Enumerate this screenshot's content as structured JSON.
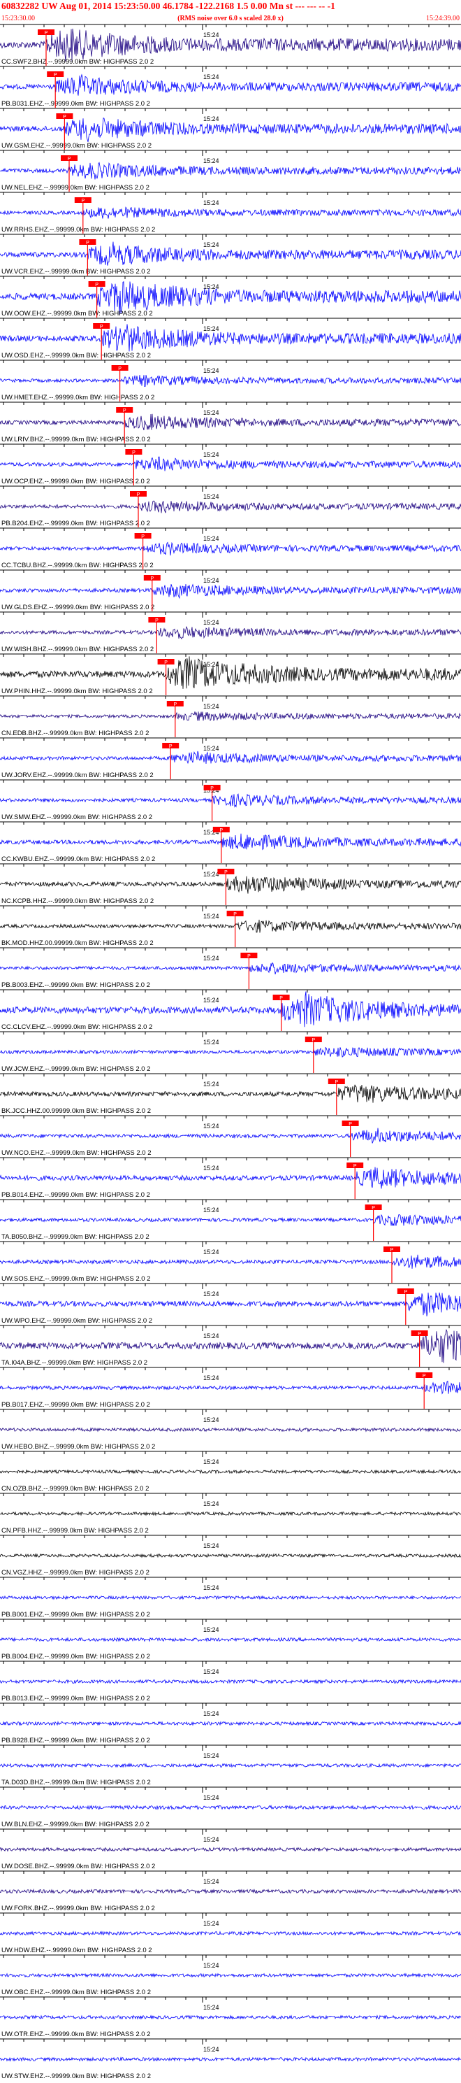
{
  "header": {
    "title": "60832282 UW Aug 01, 2014 15:23:50.00   46.1784 -122.2168  1.5 0.00 Mn st --- --- --  -1",
    "subtitle": "(RMS noise over 6.0 s scaled 28.0 x)",
    "time_start": "15:23:30.00",
    "time_end": "15:24:39.00"
  },
  "chart_data": {
    "type": "seismogram",
    "x_start": "15:23:30.00",
    "x_end": "15:24:39.00",
    "tick_label": "15:24",
    "pick_label": "P",
    "colors": {
      "blue": "#0000ff",
      "black": "#000000",
      "navy": "#1a0080",
      "pick": "#ff0000"
    },
    "traces": [
      {
        "label": "CC.SWF2.BHZ.--.99999.0km BW: HIGHPASS  2.0  2",
        "color": "navy",
        "amplitude": 1.0,
        "pick": 0.1
      },
      {
        "label": "PB.B031.EHZ.--.99999.0km BW: HIGHPASS  2.0  2",
        "color": "blue",
        "amplitude": 0.6,
        "pick": 0.12
      },
      {
        "label": "UW.GSM.EHZ.--.99999.0km BW: HIGHPASS  2.0  2",
        "color": "blue",
        "amplitude": 0.7,
        "pick": 0.14
      },
      {
        "label": "UW.NEL.EHZ.--.99999.0km BW: HIGHPASS  2.0  2",
        "color": "blue",
        "amplitude": 0.45,
        "pick": 0.15
      },
      {
        "label": "UW.RRHS.EHZ.--.99999.0km BW: HIGHPASS  2.0  2",
        "color": "blue",
        "amplitude": 0.3,
        "pick": 0.18
      },
      {
        "label": "UW.VCR.EHZ.--.99999.0km BW: HIGHPASS  2.0  2",
        "color": "blue",
        "amplitude": 0.65,
        "pick": 0.19
      },
      {
        "label": "UW.OOW.EHZ.--.99999.0km BW: HIGHPASS  2.0  2",
        "color": "blue",
        "amplitude": 1.0,
        "pick": 0.21
      },
      {
        "label": "UW.OSD.EHZ.--.99999.0km BW: HIGHPASS  2.0  2",
        "color": "blue",
        "amplitude": 0.8,
        "pick": 0.22
      },
      {
        "label": "UW.HMET.EHZ.--.99999.0km BW: HIGHPASS  2.0  2",
        "color": "blue",
        "amplitude": 0.25,
        "pick": 0.26
      },
      {
        "label": "UW.LRIV.BHZ.--.99999.0km BW: HIGHPASS  2.0  2",
        "color": "navy",
        "amplitude": 0.4,
        "pick": 0.27
      },
      {
        "label": "UW.OCP.EHZ.--.99999.0km BW: HIGHPASS  2.0  2",
        "color": "blue",
        "amplitude": 0.35,
        "pick": 0.29
      },
      {
        "label": "PB.B204.EHZ.--.99999.0km BW: HIGHPASS  2.0  2",
        "color": "navy",
        "amplitude": 0.3,
        "pick": 0.3
      },
      {
        "label": "CC.TCBU.BHZ.--.99999.0km BW: HIGHPASS  2.0  2",
        "color": "blue",
        "amplitude": 0.3,
        "pick": 0.31
      },
      {
        "label": "UW.GLDS.EHZ.--.99999.0km BW: HIGHPASS  2.0  2",
        "color": "blue",
        "amplitude": 0.35,
        "pick": 0.33
      },
      {
        "label": "UW.WISH.BHZ.--.99999.0km BW: HIGHPASS  2.0  2",
        "color": "navy",
        "amplitude": 0.3,
        "pick": 0.34
      },
      {
        "label": "UW.PHIN.HHZ.--.99999.0km BW: HIGHPASS  2.0  2",
        "color": "black",
        "amplitude": 1.0,
        "pick": 0.36
      },
      {
        "label": "CN.EDB.BHZ.--.99999.0km BW: HIGHPASS  2.0  2",
        "color": "navy",
        "amplitude": 0.2,
        "pick": 0.38
      },
      {
        "label": "UW.JORV.EHZ.--.99999.0km BW: HIGHPASS  2.0  2",
        "color": "blue",
        "amplitude": 0.3,
        "pick": 0.37
      },
      {
        "label": "UW.SMW.EHZ.--.99999.0km BW: HIGHPASS  2.0  2",
        "color": "blue",
        "amplitude": 0.3,
        "pick": 0.46
      },
      {
        "label": "CC.KWBU.EHZ.--.99999.0km BW: HIGHPASS  2.0  2",
        "color": "blue",
        "amplitude": 0.45,
        "pick": 0.48
      },
      {
        "label": "NC.KCPB.HHZ.--.99999.0km BW: HIGHPASS  2.0  2",
        "color": "black",
        "amplitude": 0.5,
        "pick": 0.49
      },
      {
        "label": "BK.MOD.HHZ.00.99999.0km BW: HIGHPASS  2.0  2",
        "color": "black",
        "amplitude": 0.3,
        "pick": 0.51
      },
      {
        "label": "PB.B003.EHZ.--.99999.0km BW: HIGHPASS  2.0  2",
        "color": "blue",
        "amplitude": 0.25,
        "pick": 0.54
      },
      {
        "label": "CC.CLCV.EHZ.--.99999.0km BW: HIGHPASS  2.0  2",
        "color": "blue",
        "amplitude": 1.0,
        "pick": 0.61
      },
      {
        "label": "UW.JCW.EHZ.--.99999.0km BW: HIGHPASS  2.0  2",
        "color": "blue",
        "amplitude": 0.25,
        "pick": 0.68
      },
      {
        "label": "BK.JCC.HHZ.00.99999.0km BW: HIGHPASS  2.0  2",
        "color": "black",
        "amplitude": 0.55,
        "pick": 0.73
      },
      {
        "label": "UW.NCO.EHZ.--.99999.0km BW: HIGHPASS  2.0  2",
        "color": "blue",
        "amplitude": 0.35,
        "pick": 0.76
      },
      {
        "label": "PB.B014.EHZ.--.99999.0km BW: HIGHPASS  2.0  2",
        "color": "blue",
        "amplitude": 0.6,
        "pick": 0.77
      },
      {
        "label": "TA.B050.BHZ.--.99999.0km BW: HIGHPASS  2.0  2",
        "color": "blue",
        "amplitude": 0.3,
        "pick": 0.81
      },
      {
        "label": "UW.SOS.EHZ.--.99999.0km BW: HIGHPASS  2.0  2",
        "color": "blue",
        "amplitude": 0.35,
        "pick": 0.85
      },
      {
        "label": "UW.WPO.EHZ.--.99999.0km BW: HIGHPASS  2.0  2",
        "color": "blue",
        "amplitude": 0.7,
        "pick": 0.88
      },
      {
        "label": "TA.I04A.BHZ.--.99999.0km BW: HIGHPASS  2.0  2",
        "color": "navy",
        "amplitude": 1.0,
        "pick": 0.91
      },
      {
        "label": "PB.B017.EHZ.--.99999.0km BW: HIGHPASS  2.0  2",
        "color": "blue",
        "amplitude": 0.3,
        "pick": 0.92
      },
      {
        "label": "UW.HEBO.BHZ.--.99999.0km BW: HIGHPASS  2.0  2",
        "color": "navy",
        "amplitude": 0.25,
        "pick": null
      },
      {
        "label": "CN.OZB.BHZ.--.99999.0km BW: HIGHPASS  2.0  2",
        "color": "black",
        "amplitude": 0.2,
        "pick": null
      },
      {
        "label": "CN.PFB.HHZ.--.99999.0km BW: HIGHPASS  2.0  2",
        "color": "black",
        "amplitude": 0.2,
        "pick": null
      },
      {
        "label": "CN.VGZ.HHZ.--.99999.0km BW: HIGHPASS  2.0  2",
        "color": "black",
        "amplitude": 0.2,
        "pick": null
      },
      {
        "label": "PB.B001.EHZ.--.99999.0km BW: HIGHPASS  2.0  2",
        "color": "blue",
        "amplitude": 0.2,
        "pick": null
      },
      {
        "label": "PB.B004.EHZ.--.99999.0km BW: HIGHPASS  2.0  2",
        "color": "blue",
        "amplitude": 0.25,
        "pick": null
      },
      {
        "label": "PB.B013.EHZ.--.99999.0km BW: HIGHPASS  2.0  2",
        "color": "blue",
        "amplitude": 0.25,
        "pick": null
      },
      {
        "label": "PB.B928.EHZ.--.99999.0km BW: HIGHPASS  2.0  2",
        "color": "blue",
        "amplitude": 0.25,
        "pick": null
      },
      {
        "label": "TA.D03D.BHZ.--.99999.0km BW: HIGHPASS  2.0  2",
        "color": "blue",
        "amplitude": 0.25,
        "pick": null
      },
      {
        "label": "UW.BLN.EHZ.--.99999.0km BW: HIGHPASS  2.0  2",
        "color": "blue",
        "amplitude": 0.3,
        "pick": null
      },
      {
        "label": "UW.DOSE.BHZ.--.99999.0km BW: HIGHPASS  2.0  2",
        "color": "navy",
        "amplitude": 0.25,
        "pick": null
      },
      {
        "label": "UW.FORK.BHZ.--.99999.0km BW: HIGHPASS  2.0  2",
        "color": "navy",
        "amplitude": 0.3,
        "pick": null
      },
      {
        "label": "UW.HDW.EHZ.--.99999.0km BW: HIGHPASS  2.0  2",
        "color": "blue",
        "amplitude": 0.25,
        "pick": null
      },
      {
        "label": "UW.OBC.EHZ.--.99999.0km BW: HIGHPASS  2.0  2",
        "color": "blue",
        "amplitude": 0.25,
        "pick": null
      },
      {
        "label": "UW.OTR.EHZ.--.99999.0km BW: HIGHPASS  2.0  2",
        "color": "blue",
        "amplitude": 0.25,
        "pick": null
      },
      {
        "label": "UW.STW.EHZ.--.99999.0km BW: HIGHPASS  2.0  2",
        "color": "blue",
        "amplitude": 0.25,
        "pick": null
      }
    ]
  }
}
